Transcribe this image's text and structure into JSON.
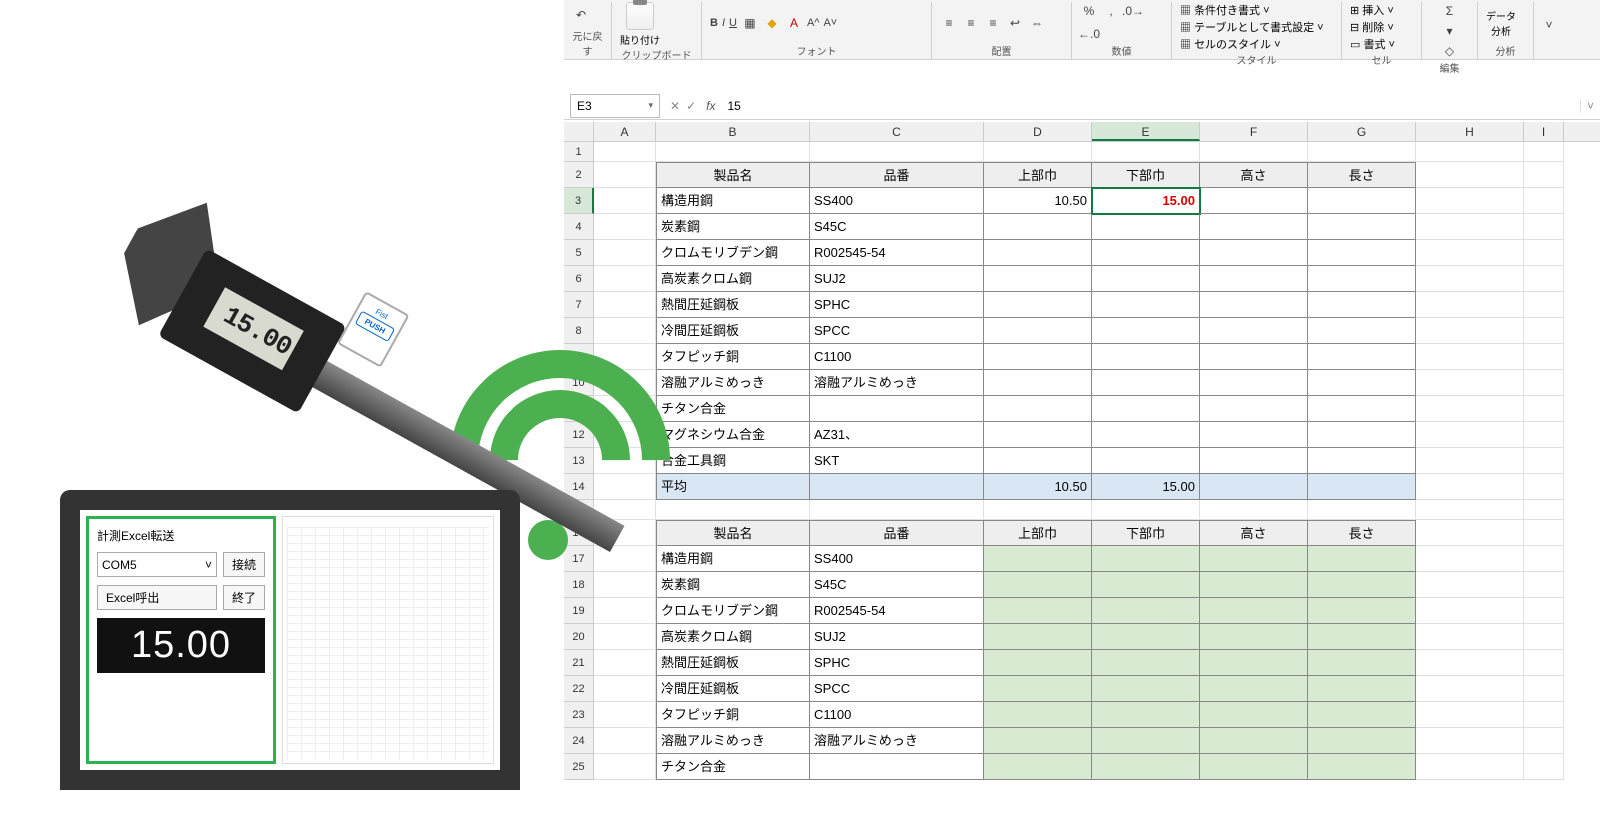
{
  "ribbon": {
    "undo_label": "元に戻す",
    "clipboard_label": "クリップボード",
    "paste_label": "貼り付け",
    "font_label": "フォント",
    "align_label": "配置",
    "number_label": "数値",
    "style_label": "スタイル",
    "cell_label": "セル",
    "edit_label": "編集",
    "analysis_label": "分析",
    "data_analysis_label": "データ\n分析",
    "cond_format_label": "条件付き書式",
    "table_format_label": "テーブルとして書式設定",
    "cell_style_label": "セルのスタイル",
    "insert_label": "挿入",
    "delete_label": "削除",
    "format_label": "書式"
  },
  "formula": {
    "cell_ref": "E3",
    "value": "15"
  },
  "columns": [
    "A",
    "B",
    "C",
    "D",
    "E",
    "F",
    "G",
    "H",
    "I"
  ],
  "table1": {
    "headers": [
      "製品名",
      "品番",
      "上部巾",
      "下部巾",
      "高さ",
      "長さ"
    ],
    "rows": [
      {
        "name": "構造用鋼",
        "code": "SS400",
        "c": "10.50",
        "d": "15.00"
      },
      {
        "name": "炭素鋼",
        "code": "S45C"
      },
      {
        "name": "クロムモリブデン鋼",
        "code": "R002545-54"
      },
      {
        "name": "高炭素クロム鋼",
        "code": "SUJ2"
      },
      {
        "name": "熱間圧延鋼板",
        "code": "SPHC"
      },
      {
        "name": "冷間圧延鋼板",
        "code": "SPCC"
      },
      {
        "name": "タフピッチ銅",
        "code": "C1100"
      },
      {
        "name": "溶融アルミめっき",
        "code": "溶融アルミめっき"
      },
      {
        "name": "チタン合金",
        "code": ""
      },
      {
        "name": "マグネシウム合金",
        "code": "AZ31、"
      },
      {
        "name": "合金工具鋼",
        "code": "SKT"
      }
    ],
    "avg_label": "平均",
    "avg_c": "10.50",
    "avg_d": "15.00"
  },
  "table2": {
    "headers": [
      "製品名",
      "品番",
      "上部巾",
      "下部巾",
      "高さ",
      "長さ"
    ],
    "rows": [
      {
        "name": "構造用鋼",
        "code": "SS400"
      },
      {
        "name": "炭素鋼",
        "code": "S45C"
      },
      {
        "name": "クロムモリブデン鋼",
        "code": "R002545-54"
      },
      {
        "name": "高炭素クロム鋼",
        "code": "SUJ2"
      },
      {
        "name": "熱間圧延鋼板",
        "code": "SPHC"
      },
      {
        "name": "冷間圧延鋼板",
        "code": "SPCC"
      },
      {
        "name": "タフピッチ銅",
        "code": "C1100"
      },
      {
        "name": "溶融アルミめっき",
        "code": "溶融アルミめっき"
      },
      {
        "name": "チタン合金",
        "code": ""
      }
    ]
  },
  "caliper": {
    "reading": "15.00",
    "push_label": "Fist",
    "push_btn": "PUSH"
  },
  "app": {
    "title": "計測Excel転送",
    "port": "COM5",
    "connect": "接続",
    "call_excel": "Excel呼出",
    "quit": "終了",
    "display": "15.00"
  }
}
